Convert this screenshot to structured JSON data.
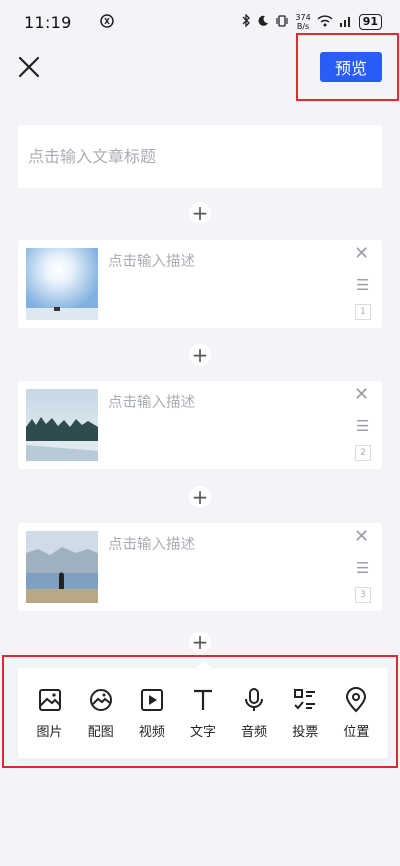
{
  "status_bar": {
    "time": "11:19",
    "center_icon": "notification-icon",
    "net_speed_value": "374",
    "net_speed_unit": "B/s",
    "battery": "91"
  },
  "header": {
    "close_icon": "close-icon",
    "preview_label": "预览"
  },
  "title_input": {
    "placeholder": "点击输入文章标题"
  },
  "add_icon_glyph": "+",
  "items": [
    {
      "description_placeholder": "点击输入描述",
      "index": "1"
    },
    {
      "description_placeholder": "点击输入描述",
      "index": "2"
    },
    {
      "description_placeholder": "点击输入描述",
      "index": "3"
    }
  ],
  "toolbar": [
    {
      "label": "图片",
      "icon": "image-icon"
    },
    {
      "label": "配图",
      "icon": "illustration-icon"
    },
    {
      "label": "视频",
      "icon": "video-icon"
    },
    {
      "label": "文字",
      "icon": "text-icon"
    },
    {
      "label": "音频",
      "icon": "microphone-icon"
    },
    {
      "label": "投票",
      "icon": "vote-icon"
    },
    {
      "label": "位置",
      "icon": "location-icon"
    }
  ],
  "colors": {
    "accent": "#2a5cf6",
    "background": "#f3f4f8",
    "highlight_border": "#e0282e"
  }
}
